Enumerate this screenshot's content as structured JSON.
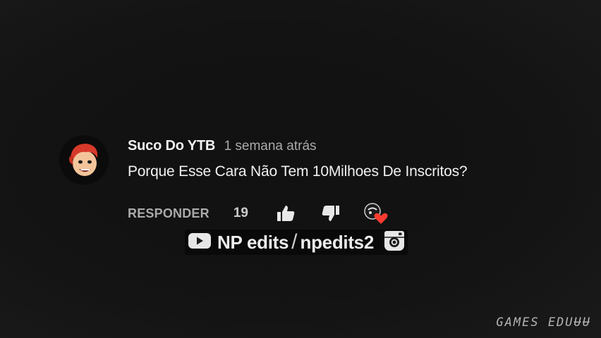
{
  "comment": {
    "author": "Suco Do YTB",
    "timestamp": "1 semana atrás",
    "text": "Porque Esse Cara Não Tem 10Milhoes De Inscritos?",
    "reply_label": "RESPONDER",
    "like_count": "19",
    "icons": {
      "like": "thumbs-up-icon",
      "dislike": "thumbs-down-icon",
      "creator_heart": "creator-heart-icon"
    }
  },
  "watermark": {
    "youtube_name": "NP edits",
    "separator": "/",
    "instagram_name": "npedits2",
    "icons": {
      "youtube": "youtube-icon",
      "instagram": "instagram-icon"
    }
  },
  "corner_mark": "GAMES EDUɄɄ",
  "colors": {
    "background": "#151515",
    "text_primary": "#f1f1f1",
    "text_secondary": "#aaaaaa",
    "heart": "#ff3b30"
  }
}
